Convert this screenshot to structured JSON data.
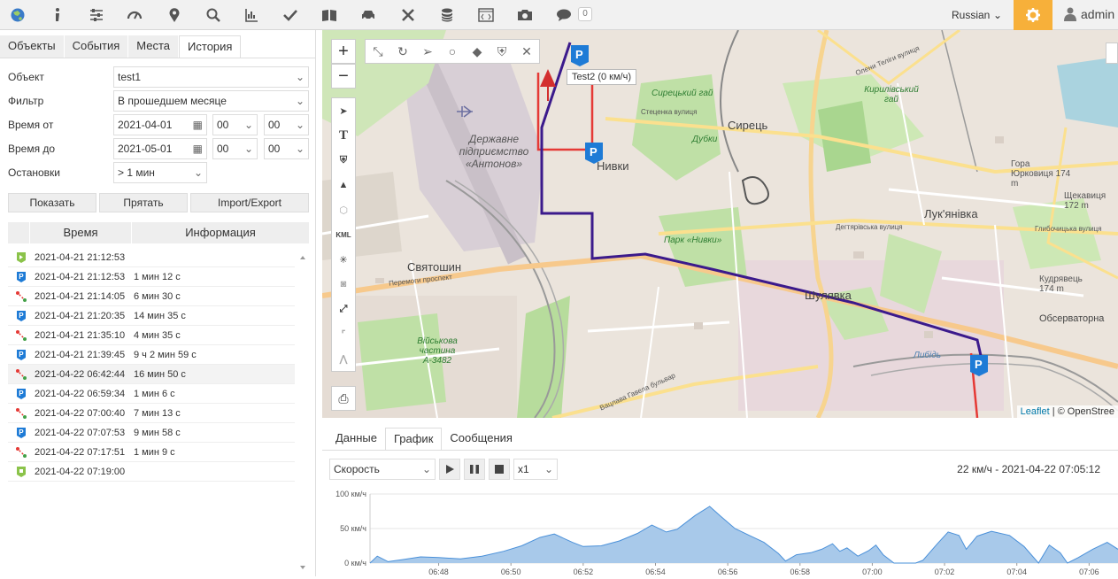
{
  "topbar": {
    "icons": [
      "globe-icon",
      "info-icon",
      "settings-sliders-icon",
      "speedometer-icon",
      "location-pin-icon",
      "search-icon",
      "chart-icon",
      "check-icon",
      "book-icon",
      "car-icon",
      "tools-icon",
      "database-icon",
      "code-icon",
      "camera-icon",
      "chat-icon"
    ],
    "notifications": "0",
    "language": "Russian",
    "user": "admin",
    "accent": "#f7b03a"
  },
  "left": {
    "tabs": [
      "Объекты",
      "События",
      "Места",
      "История"
    ],
    "active_tab": "История",
    "form": {
      "object_label": "Объект",
      "object_value": "test1",
      "filter_label": "Фильтр",
      "filter_value": "В прошедшем месяце",
      "from_label": "Время от",
      "from_date": "2021-04-01",
      "from_h": "00",
      "from_m": "00",
      "to_label": "Время до",
      "to_date": "2021-05-01",
      "to_h": "00",
      "to_m": "00",
      "stops_label": "Остановки",
      "stops_value": "> 1 мин"
    },
    "buttons": {
      "show": "Показать",
      "hide": "Прятать",
      "import": "Import/Export"
    },
    "table_headers": {
      "time": "Время",
      "info": "Информация"
    },
    "rows": [
      {
        "icon": "start",
        "time": "2021-04-21 21:12:53",
        "info": ""
      },
      {
        "icon": "parking",
        "time": "2021-04-21 21:12:53",
        "info": "1 мин 12 с"
      },
      {
        "icon": "route",
        "time": "2021-04-21 21:14:05",
        "info": "6 мин 30 с"
      },
      {
        "icon": "parking",
        "time": "2021-04-21 21:20:35",
        "info": "14 мин 35 с"
      },
      {
        "icon": "route",
        "time": "2021-04-21 21:35:10",
        "info": "4 мин 35 с"
      },
      {
        "icon": "parking",
        "time": "2021-04-21 21:39:45",
        "info": "9 ч 2 мин 59 с"
      },
      {
        "icon": "route",
        "time": "2021-04-22 06:42:44",
        "info": "16 мин 50 с"
      },
      {
        "icon": "parking",
        "time": "2021-04-22 06:59:34",
        "info": "1 мин 6 с"
      },
      {
        "icon": "route",
        "time": "2021-04-22 07:00:40",
        "info": "7 мин 13 с"
      },
      {
        "icon": "parking",
        "time": "2021-04-22 07:07:53",
        "info": "9 мин 58 с"
      },
      {
        "icon": "route",
        "time": "2021-04-22 07:17:51",
        "info": "1 мин 9 с"
      },
      {
        "icon": "finish",
        "time": "2021-04-22 07:19:00",
        "info": ""
      }
    ]
  },
  "map": {
    "tooltip": "Test2 (0 км/ч)",
    "places": [
      {
        "name": "Сирець",
        "k": "p1"
      },
      {
        "name": "Нивки",
        "k": "p2"
      },
      {
        "name": "Святошин",
        "k": "p3"
      },
      {
        "name": "Лук'янівка",
        "k": "p4"
      },
      {
        "name": "Шулявка",
        "k": "p5"
      },
      {
        "name": "Обсерваторна",
        "k": "p6"
      }
    ],
    "labels": {
      "antonov": "Державне підприємство «Антонов»",
      "park": "Парк «Нивки»",
      "syretskyi": "Сирецький гай",
      "kyrylivskyi": "Кирилівський гай",
      "dubky": "Дубки",
      "military": "Військова частина А-3482",
      "yurkovytsia": "Гора Юрковиця 174 m",
      "shchekavytsia": "Щекавиця 172 m",
      "kudryavets": "Кудрявець 174 m",
      "st_perem": "Перемоги проспект",
      "st_degtyar": "Дегтярівська вулиця",
      "st_glybochytska": "Глибочицька вулиця",
      "st_stetsenka": "Стеценка вулиця",
      "st_teliga": "Олени Теліги вулиця",
      "st_havela": "Вацлава Гавела бульвар",
      "lybid": "Либідь"
    },
    "attribution_leaflet": "Leaflet",
    "attribution_osm": "© OpenStree",
    "route_color": "#3b1a8c",
    "highlight_color": "#e53935"
  },
  "bottom": {
    "tabs": [
      "Данные",
      "График",
      "Сообщения"
    ],
    "active_tab": "График",
    "select": "Скорость",
    "speed_select": "x1",
    "readout": "22 км/ч - 2021-04-22 07:05:12"
  },
  "chart_data": {
    "type": "area",
    "ylabel": "км/ч",
    "ylim": [
      0,
      100
    ],
    "yticks": [
      "100 км/ч",
      "50 км/ч",
      "0 км/ч"
    ],
    "xticks": [
      "06:48",
      "06:50",
      "06:52",
      "06:54",
      "06:56",
      "06:58",
      "07:00",
      "07:02",
      "07:04",
      "07:06"
    ],
    "x_minutes_start": 46.1,
    "x_minutes_end": 66.8,
    "series": [
      {
        "values": [
          [
            46.1,
            0
          ],
          [
            46.3,
            10
          ],
          [
            46.6,
            2
          ],
          [
            47,
            5
          ],
          [
            47.5,
            9
          ],
          [
            48,
            8
          ],
          [
            48.6,
            6
          ],
          [
            49.2,
            10
          ],
          [
            49.8,
            17
          ],
          [
            50.3,
            25
          ],
          [
            50.8,
            37
          ],
          [
            51.2,
            42
          ],
          [
            51.7,
            30
          ],
          [
            52,
            24
          ],
          [
            52.5,
            25
          ],
          [
            53,
            32
          ],
          [
            53.5,
            43
          ],
          [
            53.9,
            55
          ],
          [
            54.3,
            45
          ],
          [
            54.6,
            49
          ],
          [
            55.1,
            69
          ],
          [
            55.5,
            82
          ],
          [
            55.8,
            68
          ],
          [
            56.2,
            50
          ],
          [
            56.6,
            40
          ],
          [
            57,
            30
          ],
          [
            57.4,
            14
          ],
          [
            57.6,
            3
          ],
          [
            57.9,
            12
          ],
          [
            58.3,
            15
          ],
          [
            58.6,
            20
          ],
          [
            58.9,
            28
          ],
          [
            59.1,
            17
          ],
          [
            59.3,
            22
          ],
          [
            59.6,
            10
          ],
          [
            59.9,
            18
          ],
          [
            60.1,
            26
          ],
          [
            60.3,
            12
          ],
          [
            60.6,
            0
          ],
          [
            61.2,
            0
          ],
          [
            61.4,
            4
          ],
          [
            61.8,
            28
          ],
          [
            62.1,
            45
          ],
          [
            62.4,
            40
          ],
          [
            62.6,
            20
          ],
          [
            62.9,
            39
          ],
          [
            63.3,
            46
          ],
          [
            63.8,
            40
          ],
          [
            64.2,
            24
          ],
          [
            64.6,
            0
          ],
          [
            64.9,
            26
          ],
          [
            65.2,
            15
          ],
          [
            65.4,
            0
          ],
          [
            65.7,
            8
          ],
          [
            66.1,
            20
          ],
          [
            66.5,
            30
          ],
          [
            66.8,
            20
          ]
        ]
      }
    ],
    "fill": "#a8c9ea",
    "stroke": "#4a90d9"
  }
}
